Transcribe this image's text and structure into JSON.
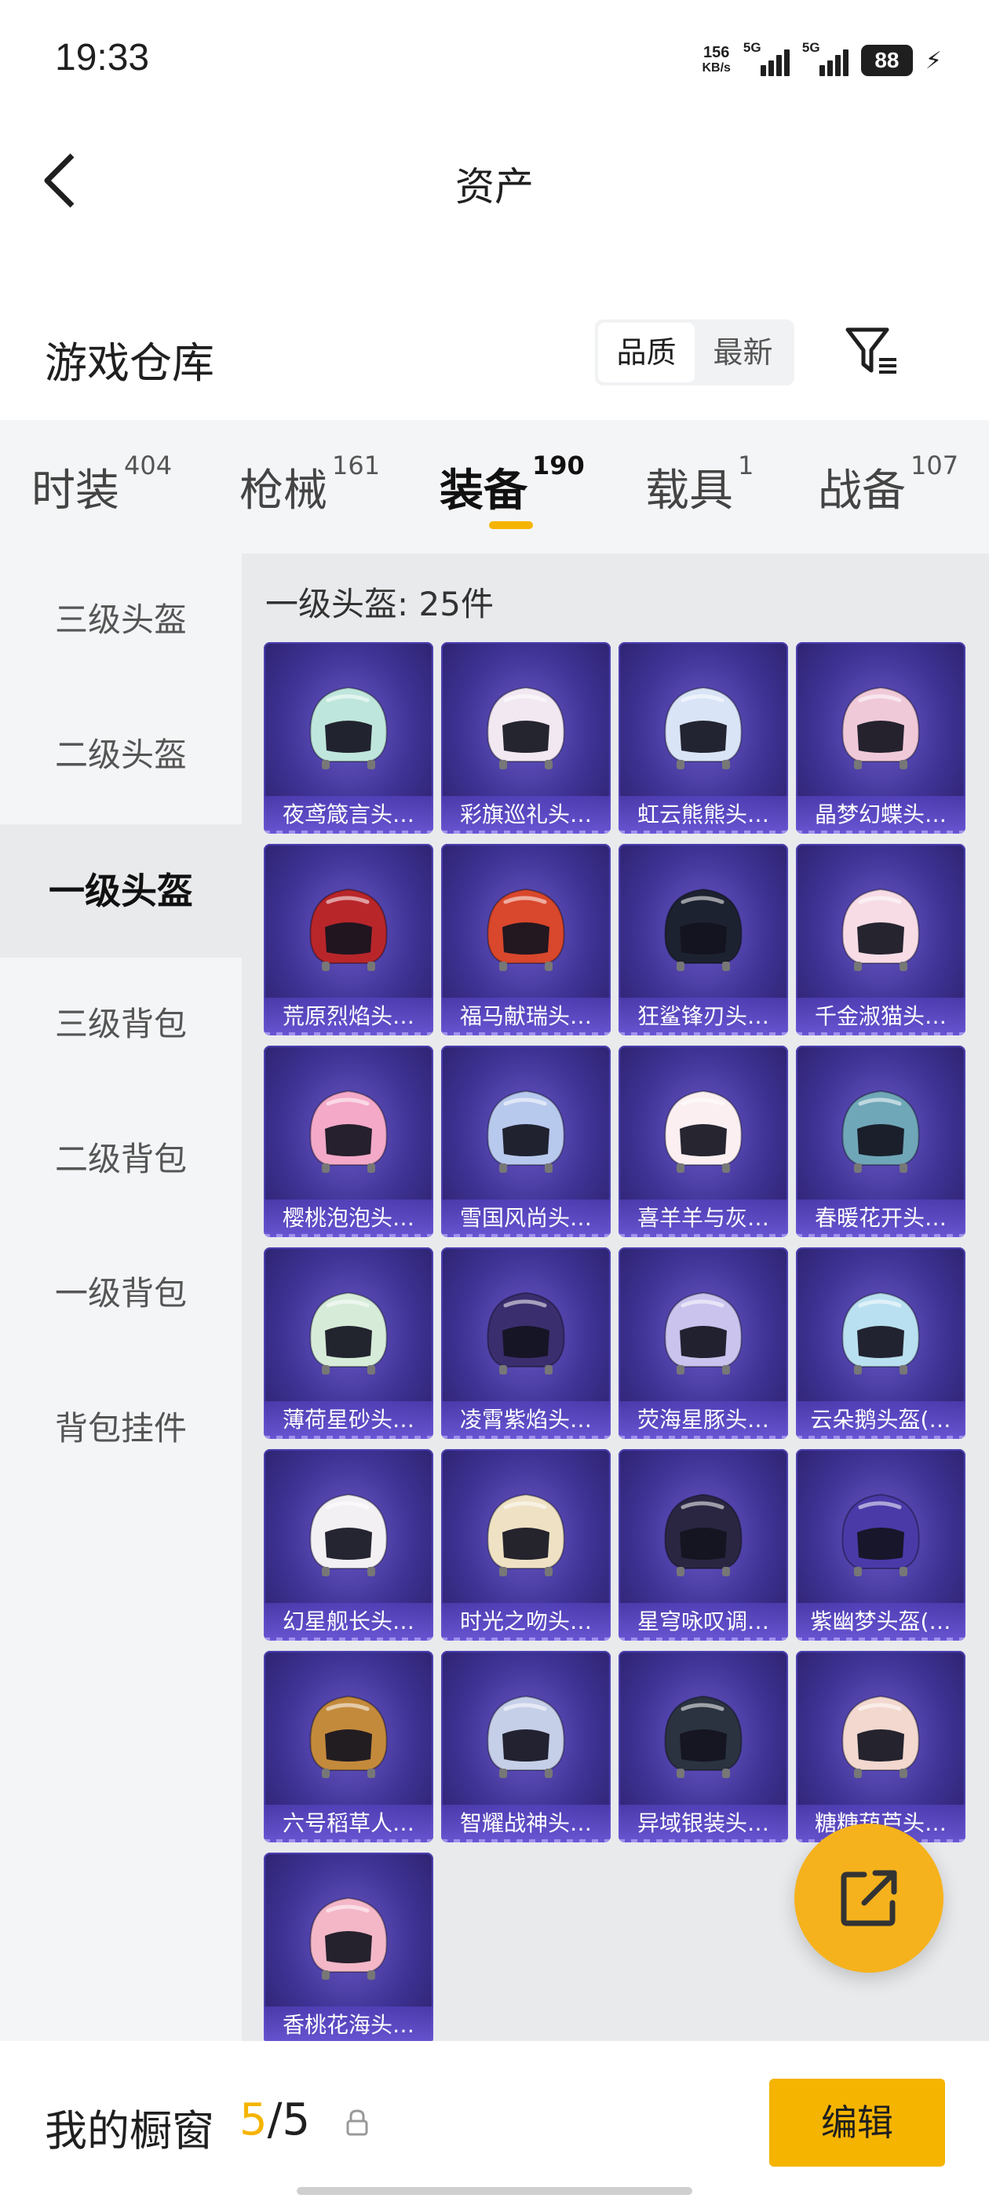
{
  "status": {
    "time": "19:33",
    "net_speed": "156",
    "net_unit": "KB/s",
    "sig1": "5G",
    "sig2": "5G",
    "battery": "88"
  },
  "header": {
    "title": "资产"
  },
  "warehouse": {
    "title": "游戏仓库",
    "sort_quality": "品质",
    "sort_latest": "最新"
  },
  "tabs": [
    {
      "label": "时装",
      "count": "404"
    },
    {
      "label": "枪械",
      "count": "161"
    },
    {
      "label": "装备",
      "count": "190"
    },
    {
      "label": "载具",
      "count": "1"
    },
    {
      "label": "战备",
      "count": "107"
    }
  ],
  "sidebar": {
    "items": [
      "三级头盔",
      "二级头盔",
      "一级头盔",
      "三级背包",
      "二级背包",
      "一级背包",
      "背包挂件"
    ],
    "active": "一级头盔"
  },
  "content": {
    "count_label": "一级头盔: 25件"
  },
  "items": [
    {
      "name": "夜鸢箴言头…",
      "color": "#bfe6dc"
    },
    {
      "name": "彩旗巡礼头…",
      "color": "#f2e8f2"
    },
    {
      "name": "虹云熊熊头…",
      "color": "#d9e4f7"
    },
    {
      "name": "晶梦幻蝶头…",
      "color": "#f0c9d8"
    },
    {
      "name": "荒原烈焰头…",
      "color": "#b8262a"
    },
    {
      "name": "福马献瑞头…",
      "color": "#d9472c"
    },
    {
      "name": "狂鲨锋刃头…",
      "color": "#1d2230"
    },
    {
      "name": "千金淑猫头…",
      "color": "#f7dce6"
    },
    {
      "name": "樱桃泡泡头…",
      "color": "#f4a9c8"
    },
    {
      "name": "雪国风尚头…",
      "color": "#b8c9ee"
    },
    {
      "name": "喜羊羊与灰…",
      "color": "#fbeff1"
    },
    {
      "name": "春暖花开头…",
      "color": "#6fa7b8"
    },
    {
      "name": "薄荷星砂头…",
      "color": "#d6ecd9"
    },
    {
      "name": "凌霄紫焰头…",
      "color": "#3b2e6e"
    },
    {
      "name": "荧海星豚头…",
      "color": "#c9c3ee"
    },
    {
      "name": "云朵鹅头盔(…",
      "color": "#b9e0f0"
    },
    {
      "name": "幻星舰长头…",
      "color": "#f3f0f4"
    },
    {
      "name": "时光之吻头…",
      "color": "#efe2c4"
    },
    {
      "name": "星穹咏叹调…",
      "color": "#2a2642"
    },
    {
      "name": "紫幽梦头盔(…",
      "color": "#4a3aa8"
    },
    {
      "name": "六号稻草人…",
      "color": "#c48a3c"
    },
    {
      "name": "智耀战神头…",
      "color": "#c6cfe8"
    },
    {
      "name": "异域银装头…",
      "color": "#2b3340"
    },
    {
      "name": "糖糖葫芦头…",
      "color": "#f2d8cf"
    },
    {
      "name": "香桃花海头…",
      "color": "#f3b7c8"
    }
  ],
  "bottom": {
    "showcase_label": "我的橱窗",
    "showcase_current": "5",
    "showcase_total": "/5",
    "edit_label": "编辑"
  },
  "colors": {
    "accent": "#f5b400",
    "card_bg": "#3e3294"
  }
}
